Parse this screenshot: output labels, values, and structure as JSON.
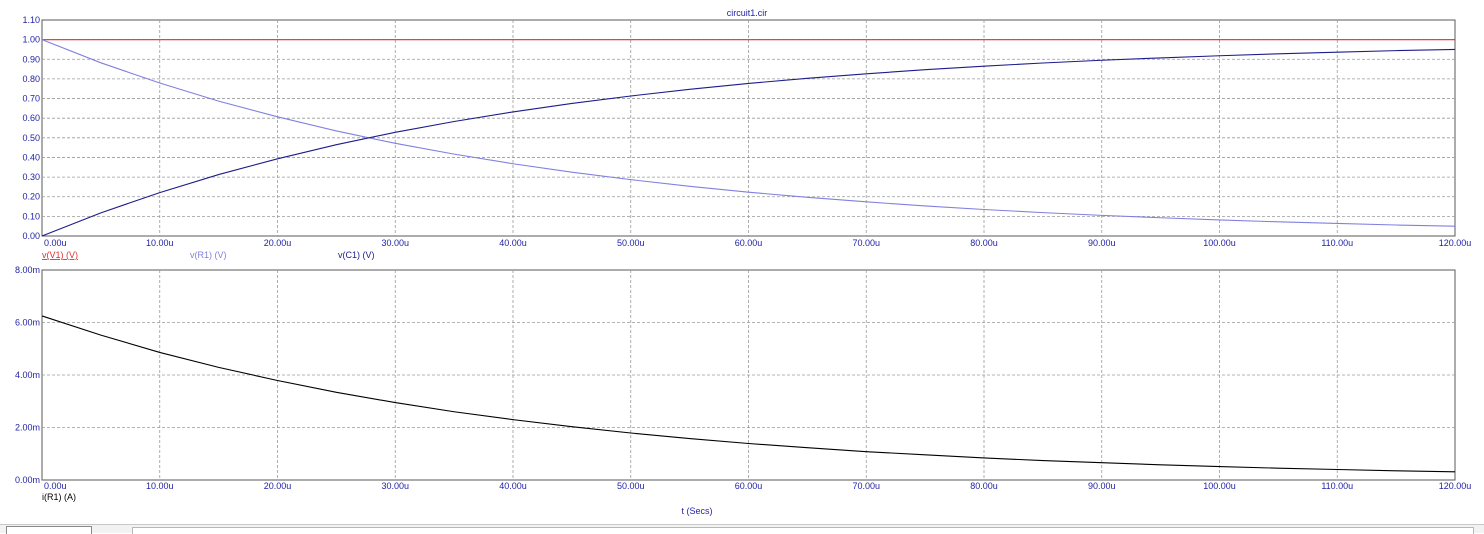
{
  "window": {
    "title": "circuit1.cir",
    "x_axis_label": "t (Secs)"
  },
  "colors": {
    "vV1": "#e03030",
    "vR1": "#8080e0",
    "vC1": "#1c1c8c",
    "iR1": "#000000",
    "tick_text": "#2323a6",
    "grid": "#9a9a9a"
  },
  "chart_data": [
    {
      "type": "line",
      "title": "circuit1.cir",
      "xlabel": "",
      "ylabel": "",
      "x_ticks": [
        "0.00u",
        "10.00u",
        "20.00u",
        "30.00u",
        "40.00u",
        "50.00u",
        "60.00u",
        "70.00u",
        "80.00u",
        "90.00u",
        "100.00u",
        "110.00u",
        "120.00u"
      ],
      "y_ticks": [
        "0.00",
        "0.10",
        "0.20",
        "0.30",
        "0.40",
        "0.50",
        "0.60",
        "0.70",
        "0.80",
        "0.90",
        "1.00",
        "1.10"
      ],
      "xlim": [
        0,
        120
      ],
      "ylim": [
        0,
        1.1
      ],
      "grid": true,
      "legend_position": "bottom-left",
      "x": [
        0,
        5,
        10,
        15,
        20,
        25,
        30,
        35,
        40,
        45,
        50,
        55,
        60,
        65,
        70,
        75,
        80,
        85,
        90,
        95,
        100,
        105,
        110,
        115,
        120
      ],
      "series": [
        {
          "name": "v(V1) (V)",
          "values": [
            1,
            1,
            1,
            1,
            1,
            1,
            1,
            1,
            1,
            1,
            1,
            1,
            1,
            1,
            1,
            1,
            1,
            1,
            1,
            1,
            1,
            1,
            1,
            1,
            1
          ]
        },
        {
          "name": "v(R1) (V)",
          "values": [
            1.0,
            0.882,
            0.779,
            0.687,
            0.607,
            0.535,
            0.472,
            0.417,
            0.368,
            0.325,
            0.287,
            0.253,
            0.223,
            0.197,
            0.174,
            0.153,
            0.135,
            0.119,
            0.105,
            0.093,
            0.082,
            0.072,
            0.064,
            0.056,
            0.05
          ]
        },
        {
          "name": "v(C1) (V)",
          "values": [
            0.0,
            0.118,
            0.221,
            0.313,
            0.393,
            0.465,
            0.528,
            0.583,
            0.632,
            0.675,
            0.713,
            0.747,
            0.777,
            0.803,
            0.826,
            0.847,
            0.865,
            0.881,
            0.895,
            0.907,
            0.918,
            0.928,
            0.936,
            0.944,
            0.95
          ]
        }
      ]
    },
    {
      "type": "line",
      "xlabel": "t (Secs)",
      "ylabel": "",
      "x_ticks": [
        "0.00u",
        "10.00u",
        "20.00u",
        "30.00u",
        "40.00u",
        "50.00u",
        "60.00u",
        "70.00u",
        "80.00u",
        "90.00u",
        "100.00u",
        "110.00u",
        "120.00u"
      ],
      "y_ticks": [
        "0.00m",
        "2.00m",
        "4.00m",
        "6.00m",
        "8.00m"
      ],
      "xlim": [
        0,
        120
      ],
      "ylim": [
        0,
        8
      ],
      "grid": true,
      "legend_position": "bottom-left",
      "x": [
        0,
        5,
        10,
        15,
        20,
        25,
        30,
        35,
        40,
        45,
        50,
        55,
        60,
        65,
        70,
        75,
        80,
        85,
        90,
        95,
        100,
        105,
        110,
        115,
        120
      ],
      "series": [
        {
          "name": "i(R1) (A)",
          "values": [
            6.25,
            5.52,
            4.86,
            4.29,
            3.79,
            3.34,
            2.95,
            2.6,
            2.3,
            2.03,
            1.79,
            1.58,
            1.39,
            1.23,
            1.08,
            0.96,
            0.84,
            0.74,
            0.66,
            0.58,
            0.51,
            0.45,
            0.4,
            0.35,
            0.31
          ]
        }
      ]
    }
  ]
}
